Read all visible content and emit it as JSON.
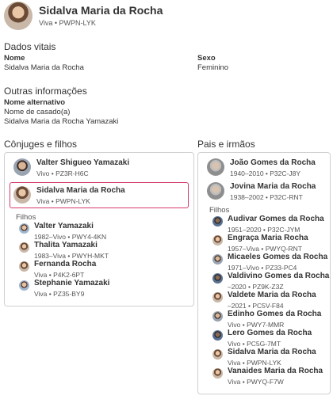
{
  "person": {
    "name": "Sidalva Maria da Rocha",
    "status": "Viva • PWPN-LYK"
  },
  "vitals": {
    "heading": "Dados vitais",
    "name_label": "Nome",
    "name_value": "Sidalva Maria da Rocha",
    "sex_label": "Sexo",
    "sex_value": "Feminino"
  },
  "other": {
    "heading": "Outras informações",
    "alt_label": "Nome alternativo",
    "alt_type": "Nome de casado(a)",
    "alt_value": "Sidalva Maria da Rocha Yamazaki"
  },
  "spouses": {
    "heading": "Cônjuges e filhos",
    "spouse": {
      "name": "Valter Shigueo Yamazaki",
      "meta": "Vivo • PZ3R-H6C"
    },
    "self": {
      "name": "Sidalva Maria da Rocha",
      "meta": "Viva • PWPN-LYK"
    },
    "children_label": "Filhos",
    "children": [
      {
        "name": "Valter Yamazaki",
        "meta": "1982–Vivo • PWY4-4KN"
      },
      {
        "name": "Thalita Yamazaki",
        "meta": "1983–Viva • PWYH-MKT"
      },
      {
        "name": "Fernanda Rocha",
        "meta": "Viva • P4K2-6PT"
      },
      {
        "name": "Stephanie Yamazaki",
        "meta": "Viva • PZ35-BY9"
      }
    ]
  },
  "parents": {
    "heading": "Pais e irmãos",
    "father": {
      "name": "João Gomes da Rocha",
      "meta": "1940–2010 • P32C-J8Y"
    },
    "mother": {
      "name": "Jovina Maria da Rocha",
      "meta": "1938–2002 • P32C-RNT"
    },
    "children_label": "Filhos",
    "siblings": [
      {
        "name": "Audivar Gomes da Rocha",
        "meta": "1951–2020 • P32C-JYM"
      },
      {
        "name": "Engraça Maria Rocha",
        "meta": "1957–Viva • PWYQ-RNT"
      },
      {
        "name": "Micaeles Gomes da Rocha",
        "meta": "1971–Vivo • PZ33-PC4"
      },
      {
        "name": "Valdivino Gomes da Rocha",
        "meta": "–2020 • PZ9K-Z3Z"
      },
      {
        "name": "Valdete Maria da Rocha",
        "meta": "–2021 • PC5V-F84"
      },
      {
        "name": "Edinho Gomes da Rocha",
        "meta": "Vivo • PWY7-MMR"
      },
      {
        "name": "Lero Gomes da Rocha",
        "meta": "Vivo • PC5G-7MT"
      },
      {
        "name": "Sidalva Maria da Rocha",
        "meta": "Viva • PWPN-LYK"
      },
      {
        "name": "Vanaides Maria da Rocha",
        "meta": "Viva • PWYQ-F7W"
      }
    ]
  }
}
